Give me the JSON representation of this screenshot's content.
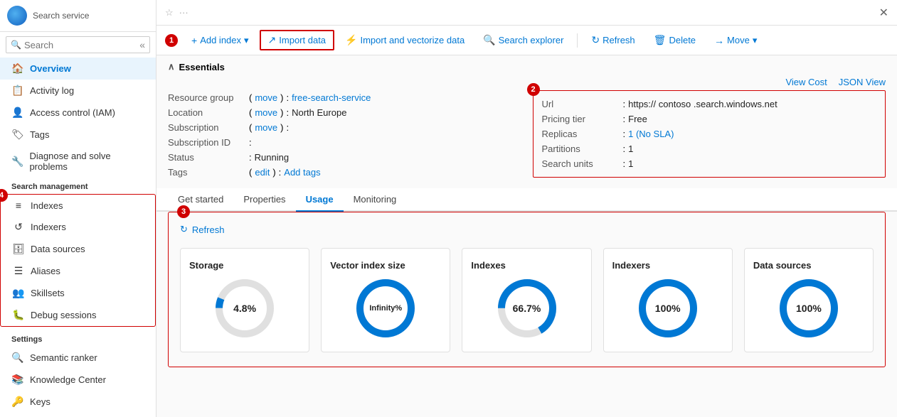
{
  "sidebar": {
    "logo_alt": "Azure",
    "service_label": "Search service",
    "search_placeholder": "Search",
    "collapse_icon": "«",
    "nav_items": [
      {
        "id": "overview",
        "label": "Overview",
        "icon": "🏠",
        "active": true
      },
      {
        "id": "activity-log",
        "label": "Activity log",
        "icon": "📋",
        "active": false
      },
      {
        "id": "access-control",
        "label": "Access control (IAM)",
        "icon": "👤",
        "active": false
      },
      {
        "id": "tags",
        "label": "Tags",
        "icon": "🏷",
        "active": false
      },
      {
        "id": "diagnose",
        "label": "Diagnose and solve problems",
        "icon": "🔧",
        "active": false
      }
    ],
    "search_management_label": "Search management",
    "search_management_items": [
      {
        "id": "indexes",
        "label": "Indexes",
        "icon": "≡"
      },
      {
        "id": "indexers",
        "label": "Indexers",
        "icon": "↺"
      },
      {
        "id": "data-sources",
        "label": "Data sources",
        "icon": "🗄"
      },
      {
        "id": "aliases",
        "label": "Aliases",
        "icon": "☰"
      },
      {
        "id": "skillsets",
        "label": "Skillsets",
        "icon": "👥"
      },
      {
        "id": "debug-sessions",
        "label": "Debug sessions",
        "icon": "🐛"
      }
    ],
    "settings_label": "Settings",
    "settings_items": [
      {
        "id": "semantic-ranker",
        "label": "Semantic ranker",
        "icon": "🔍"
      },
      {
        "id": "knowledge-center",
        "label": "Knowledge Center",
        "icon": "📚"
      },
      {
        "id": "keys",
        "label": "Keys",
        "icon": "🔑"
      }
    ]
  },
  "toolbar": {
    "add_index_label": "Add index",
    "import_data_label": "Import data",
    "import_vectorize_label": "Import and vectorize data",
    "search_explorer_label": "Search explorer",
    "refresh_label": "Refresh",
    "delete_label": "Delete",
    "move_label": "Move",
    "badge1": "1",
    "highlight_badge": "1"
  },
  "essentials": {
    "header": "Essentials",
    "view_cost_label": "View Cost",
    "json_view_label": "JSON View",
    "resource_group_label": "Resource group",
    "resource_group_move": "move",
    "resource_group_value": "free-search-service",
    "location_label": "Location",
    "location_move": "move",
    "location_value": "North Europe",
    "subscription_label": "Subscription",
    "subscription_move": "move",
    "subscription_value": "",
    "subscription_id_label": "Subscription ID",
    "subscription_id_value": "",
    "status_label": "Status",
    "status_value": "Running",
    "tags_label": "Tags",
    "tags_edit": "edit",
    "tags_value": "Add tags",
    "url_label": "Url",
    "url_value": "https:// contoso .search.windows.net",
    "pricing_tier_label": "Pricing tier",
    "pricing_tier_value": "Free",
    "replicas_label": "Replicas",
    "replicas_value": "1 (No SLA)",
    "partitions_label": "Partitions",
    "partitions_value": "1",
    "search_units_label": "Search units",
    "search_units_value": "1",
    "badge2": "2"
  },
  "tabs": {
    "items": [
      {
        "id": "get-started",
        "label": "Get started",
        "active": false
      },
      {
        "id": "properties",
        "label": "Properties",
        "active": false
      },
      {
        "id": "usage",
        "label": "Usage",
        "active": true
      },
      {
        "id": "monitoring",
        "label": "Monitoring",
        "active": false
      }
    ],
    "badge3": "3",
    "refresh_label": "Refresh",
    "usage_cards": [
      {
        "id": "storage",
        "title": "Storage",
        "value": "4.8%",
        "percentage": 4.8,
        "color_used": "#0078d4",
        "color_unused": "#e0e0e0",
        "large_arc": false
      },
      {
        "id": "vector-index-size",
        "title": "Vector index size",
        "value": "Infinity%",
        "percentage": 100,
        "color_used": "#0078d4",
        "color_unused": "#0078d4",
        "large_arc": true
      },
      {
        "id": "indexes",
        "title": "Indexes",
        "value": "66.7%",
        "percentage": 66.7,
        "color_used": "#0078d4",
        "color_unused": "#e0e0e0",
        "large_arc": true
      },
      {
        "id": "indexers",
        "title": "Indexers",
        "value": "100%",
        "percentage": 100,
        "color_used": "#0078d4",
        "color_unused": "#0078d4",
        "large_arc": true
      },
      {
        "id": "data-sources",
        "title": "Data sources",
        "value": "100%",
        "percentage": 100,
        "color_used": "#0078d4",
        "color_unused": "#0078d4",
        "large_arc": true
      }
    ]
  },
  "badges": {
    "badge4": "4"
  }
}
